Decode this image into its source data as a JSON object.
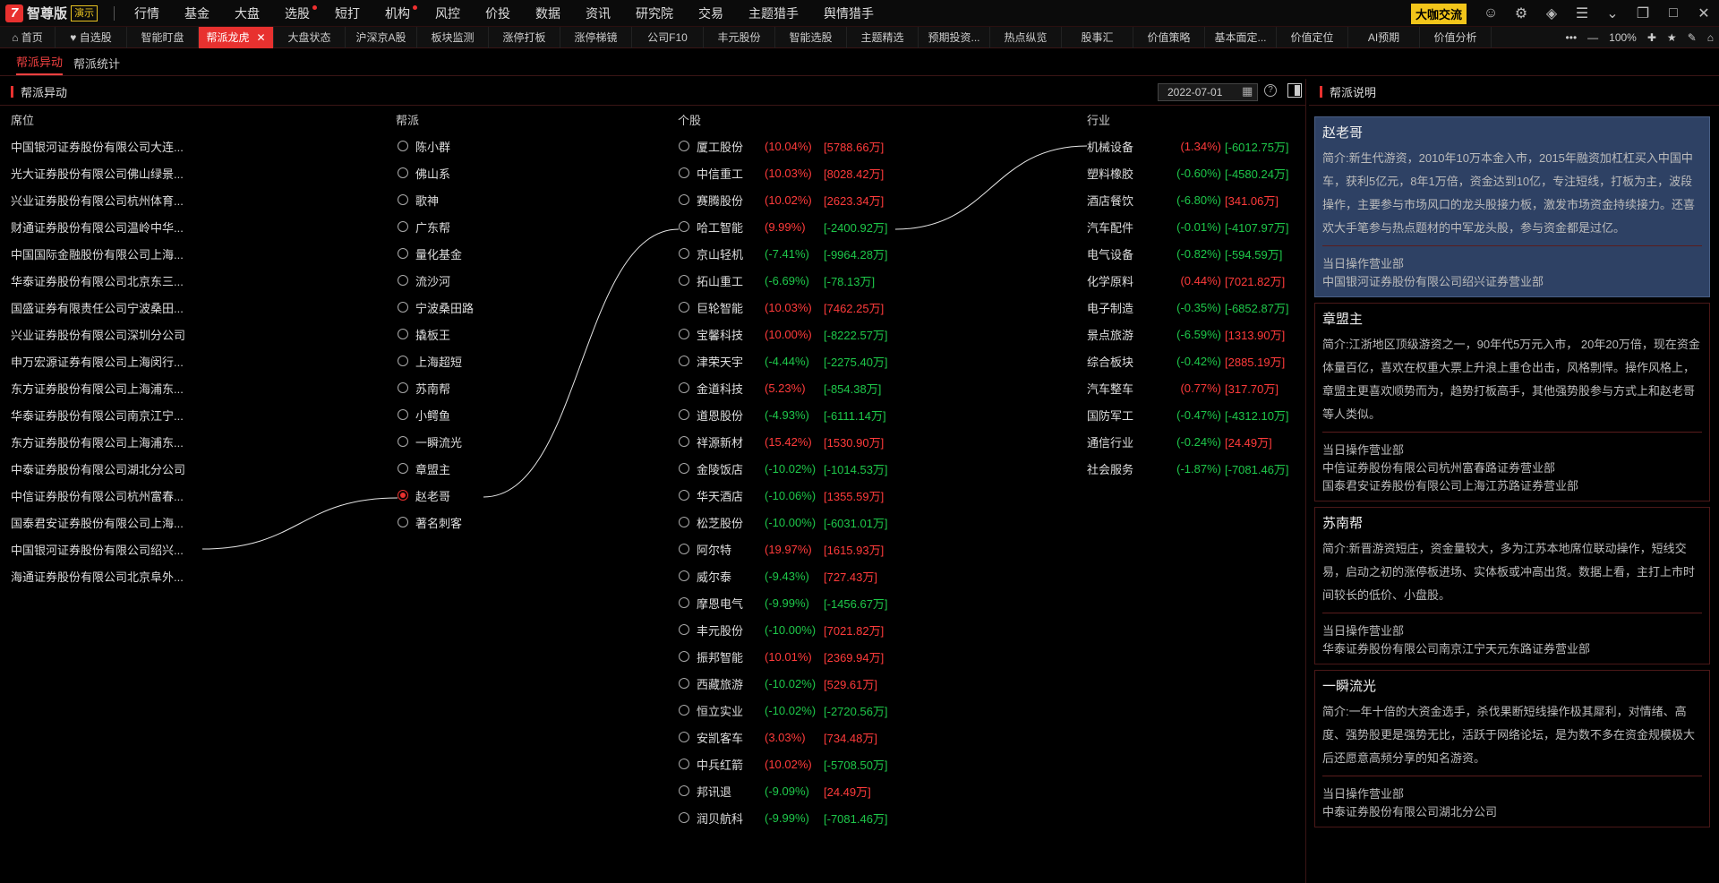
{
  "app": {
    "logo_mark": "7",
    "name": "智尊版",
    "demo_badge": "演示",
    "menu": [
      {
        "label": "行情",
        "dot": false
      },
      {
        "label": "基金",
        "dot": false
      },
      {
        "label": "大盘",
        "dot": false
      },
      {
        "label": "选股",
        "dot": true
      },
      {
        "label": "短打",
        "dot": false
      },
      {
        "label": "机构",
        "dot": true
      },
      {
        "label": "风控",
        "dot": false
      },
      {
        "label": "价投",
        "dot": false
      },
      {
        "label": "数据",
        "dot": false
      },
      {
        "label": "资讯",
        "dot": false
      },
      {
        "label": "研究院",
        "dot": false
      },
      {
        "label": "交易",
        "dot": false
      },
      {
        "label": "主题猎手",
        "dot": false
      },
      {
        "label": "舆情猎手",
        "dot": false
      }
    ],
    "top_button": "大咖交流"
  },
  "tabs": [
    {
      "label": "首页",
      "icon": "home-icon",
      "w": 62
    },
    {
      "label": "自选股",
      "icon": "heart-icon",
      "w": 80
    },
    {
      "label": "智能盯盘",
      "w": 80
    },
    {
      "label": "帮派龙虎",
      "w": 84,
      "active": true,
      "closable": true
    },
    {
      "label": "大盘状态",
      "w": 80
    },
    {
      "label": "沪深京A股",
      "w": 80
    },
    {
      "label": "板块监测",
      "w": 80
    },
    {
      "label": "涨停打板",
      "w": 80
    },
    {
      "label": "涨停梯镜",
      "w": 80
    },
    {
      "label": "公司F10",
      "w": 80
    },
    {
      "label": "丰元股份",
      "w": 80
    },
    {
      "label": "智能选股",
      "w": 80
    },
    {
      "label": "主题精选",
      "w": 80
    },
    {
      "label": "预期投资...",
      "w": 80
    },
    {
      "label": "热点纵览",
      "w": 80
    },
    {
      "label": "股事汇",
      "w": 80
    },
    {
      "label": "价值策略",
      "w": 80
    },
    {
      "label": "基本面定...",
      "w": 80
    },
    {
      "label": "价值定位",
      "w": 80
    },
    {
      "label": "AI预期",
      "w": 80
    },
    {
      "label": "价值分析",
      "w": 80
    }
  ],
  "zoom": "100%",
  "subtabs": [
    {
      "label": "帮派异动",
      "active": true
    },
    {
      "label": "帮派统计",
      "active": false
    }
  ],
  "left": {
    "title": "帮派异动",
    "date": "2022-07-01",
    "headers": {
      "seat": "席位",
      "gang": "帮派",
      "stock": "个股",
      "industry": "行业"
    },
    "seats": [
      "中国银河证券股份有限公司大连...",
      "光大证券股份有限公司佛山绿景...",
      "兴业证券股份有限公司杭州体育...",
      "财通证券股份有限公司温岭中华...",
      "中国国际金融股份有限公司上海...",
      "华泰证券股份有限公司北京东三...",
      "国盛证券有限责任公司宁波桑田...",
      "兴业证券股份有限公司深圳分公司",
      "申万宏源证券有限公司上海闵行...",
      "东方证券股份有限公司上海浦东...",
      "华泰证券股份有限公司南京江宁...",
      "东方证券股份有限公司上海浦东...",
      "中泰证券股份有限公司湖北分公司",
      "中信证券股份有限公司杭州富春...",
      "国泰君安证券股份有限公司上海...",
      "中国银河证券股份有限公司绍兴...",
      "海通证券股份有限公司北京阜外..."
    ],
    "gangs": [
      {
        "name": "陈小群"
      },
      {
        "name": "佛山系"
      },
      {
        "name": "歌神"
      },
      {
        "name": "广东帮"
      },
      {
        "name": "量化基金"
      },
      {
        "name": "流沙河"
      },
      {
        "name": "宁波桑田路"
      },
      {
        "name": "撬板王"
      },
      {
        "name": "上海超短"
      },
      {
        "name": "苏南帮"
      },
      {
        "name": "小鳄鱼"
      },
      {
        "name": "一瞬流光"
      },
      {
        "name": "章盟主"
      },
      {
        "name": "赵老哥",
        "selected": true
      },
      {
        "name": "著名刺客"
      }
    ],
    "stocks": [
      {
        "name": "厦工股份",
        "pct": "(10.04%)",
        "amt": "[5788.66万]",
        "up": true
      },
      {
        "name": "中信重工",
        "pct": "(10.03%)",
        "amt": "[8028.42万]",
        "up": true
      },
      {
        "name": "赛腾股份",
        "pct": "(10.02%)",
        "amt": "[2623.34万]",
        "up": true
      },
      {
        "name": "哈工智能",
        "pct": "(9.99%)",
        "amt": "[-2400.92万]",
        "up": true,
        "amt_down": true
      },
      {
        "name": "京山轻机",
        "pct": "(-7.41%)",
        "amt": "[-9964.28万]",
        "up": false
      },
      {
        "name": "拓山重工",
        "pct": "(-6.69%)",
        "amt": "[-78.13万]",
        "up": false
      },
      {
        "name": "巨轮智能",
        "pct": "(10.03%)",
        "amt": "[7462.25万]",
        "up": true
      },
      {
        "name": "宝馨科技",
        "pct": "(10.00%)",
        "amt": "[-8222.57万]",
        "up": true,
        "amt_down": true
      },
      {
        "name": "津荣天宇",
        "pct": "(-4.44%)",
        "amt": "[-2275.40万]",
        "up": false
      },
      {
        "name": "金道科技",
        "pct": "(5.23%)",
        "amt": "[-854.38万]",
        "up": true,
        "amt_down": true
      },
      {
        "name": "道恩股份",
        "pct": "(-4.93%)",
        "amt": "[-6111.14万]",
        "up": false
      },
      {
        "name": "祥源新材",
        "pct": "(15.42%)",
        "amt": "[1530.90万]",
        "up": true
      },
      {
        "name": "金陵饭店",
        "pct": "(-10.02%)",
        "amt": "[-1014.53万]",
        "up": false
      },
      {
        "name": "华天酒店",
        "pct": "(-10.06%)",
        "amt": "[1355.59万]",
        "up": false,
        "amt_up": true
      },
      {
        "name": "松芝股份",
        "pct": "(-10.00%)",
        "amt": "[-6031.01万]",
        "up": false
      },
      {
        "name": "阿尔特",
        "pct": "(19.97%)",
        "amt": "[1615.93万]",
        "up": true
      },
      {
        "name": "威尔泰",
        "pct": "(-9.43%)",
        "amt": "[727.43万]",
        "up": false,
        "amt_up": true
      },
      {
        "name": "摩恩电气",
        "pct": "(-9.99%)",
        "amt": "[-1456.67万]",
        "up": false
      },
      {
        "name": "丰元股份",
        "pct": "(-10.00%)",
        "amt": "[7021.82万]",
        "up": false,
        "amt_up": true
      },
      {
        "name": "振邦智能",
        "pct": "(10.01%)",
        "amt": "[2369.94万]",
        "up": true
      },
      {
        "name": "西藏旅游",
        "pct": "(-10.02%)",
        "amt": "[529.61万]",
        "up": false,
        "amt_up": true
      },
      {
        "name": "恒立实业",
        "pct": "(-10.02%)",
        "amt": "[-2720.56万]",
        "up": false
      },
      {
        "name": "安凯客车",
        "pct": "(3.03%)",
        "amt": "[734.48万]",
        "up": true
      },
      {
        "name": "中兵红箭",
        "pct": "(10.02%)",
        "amt": "[-5708.50万]",
        "up": true,
        "amt_down": true
      },
      {
        "name": "邦讯退",
        "pct": "(-9.09%)",
        "amt": "[24.49万]",
        "up": false,
        "amt_up": true
      },
      {
        "name": "润贝航科",
        "pct": "(-9.99%)",
        "amt": "[-7081.46万]",
        "up": false
      }
    ],
    "industries": [
      {
        "name": "机械设备",
        "pct": "(1.34%)",
        "amt": "[-6012.75万]",
        "up": true,
        "amt_down": true
      },
      {
        "name": "塑料橡胶",
        "pct": "(-0.60%)",
        "amt": "[-4580.24万]",
        "up": false
      },
      {
        "name": "酒店餐饮",
        "pct": "(-6.80%)",
        "amt": "[341.06万]",
        "up": false,
        "amt_up": true
      },
      {
        "name": "汽车配件",
        "pct": "(-0.01%)",
        "amt": "[-4107.97万]",
        "up": false
      },
      {
        "name": "电气设备",
        "pct": "(-0.82%)",
        "amt": "[-594.59万]",
        "up": false
      },
      {
        "name": "化学原料",
        "pct": "(0.44%)",
        "amt": "[7021.82万]",
        "up": true
      },
      {
        "name": "电子制造",
        "pct": "(-0.35%)",
        "amt": "[-6852.87万]",
        "up": false
      },
      {
        "name": "景点旅游",
        "pct": "(-6.59%)",
        "amt": "[1313.90万]",
        "up": false,
        "amt_up": true
      },
      {
        "name": "综合板块",
        "pct": "(-0.42%)",
        "amt": "[2885.19万]",
        "up": false,
        "amt_up": true
      },
      {
        "name": "汽车整车",
        "pct": "(0.77%)",
        "amt": "[317.70万]",
        "up": true
      },
      {
        "name": "国防军工",
        "pct": "(-0.47%)",
        "amt": "[-4312.10万]",
        "up": false
      },
      {
        "name": "通信行业",
        "pct": "(-0.24%)",
        "amt": "[24.49万]",
        "up": false,
        "amt_up": true
      },
      {
        "name": "社会服务",
        "pct": "(-1.87%)",
        "amt": "[-7081.46万]",
        "up": false
      }
    ]
  },
  "right": {
    "title": "帮派说明",
    "oplabel": "当日操作营业部",
    "cards": [
      {
        "name": "赵老哥",
        "selected": true,
        "intro": "简介:新生代游资，2010年10万本金入市，2015年融资加杠杠买入中国中车，获利5亿元，8年1万倍，资金达到10亿，专注短线，打板为主，波段操作，主要参与市场风口的龙头股接力板，激发市场资金持续接力。还喜欢大手笔参与热点题材的中军龙头股，参与资金都是过亿。",
        "ops": [
          "中国银河证券股份有限公司绍兴证券营业部"
        ]
      },
      {
        "name": "章盟主",
        "intro": "简介:江浙地区顶级游资之一，90年代5万元入市， 20年20万倍，现在资金体量百亿，喜欢在权重大票上升浪上重仓出击，风格剽悍。操作风格上，章盟主更喜欢顺势而为，趋势打板高手，其他强势股参与方式上和赵老哥等人类似。",
        "ops": [
          "中信证券股份有限公司杭州富春路证券营业部",
          "国泰君安证券股份有限公司上海江苏路证券营业部"
        ]
      },
      {
        "name": "苏南帮",
        "intro": "简介:新晋游资短庄，资金量较大，多为江苏本地席位联动操作，短线交易，启动之初的涨停板进场、实体板或冲高出货。数据上看，主打上市时间较长的低价、小盘股。",
        "ops": [
          "华泰证券股份有限公司南京江宁天元东路证券营业部"
        ]
      },
      {
        "name": "一瞬流光",
        "intro": "简介:一年十倍的大资金选手，杀伐果断短线操作极其犀利，对情绪、高度、强势股更是强势无比，活跃于网络论坛，是为数不多在资金规模极大后还愿意高频分享的知名游资。",
        "ops": [
          "中泰证券股份有限公司湖北分公司"
        ]
      }
    ]
  }
}
